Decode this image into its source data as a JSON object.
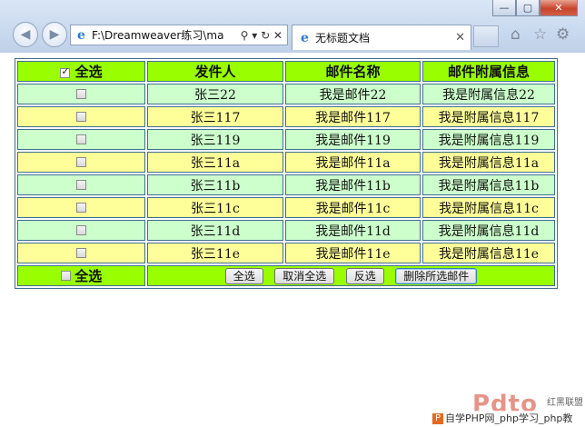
{
  "window": {
    "minimize_glyph": "—",
    "maximize_glyph": "▢",
    "close_glyph": "✕"
  },
  "browser": {
    "address": "F:\\Dreamweaver练习\\ma",
    "address_controls": "⚲ ▾ ↻ ✕",
    "tab_title": "无标题文档",
    "tab_close": "✕",
    "icons": [
      "back-icon",
      "forward-icon",
      "ie-icon",
      "home-icon",
      "star-icon",
      "gear-icon"
    ]
  },
  "table": {
    "headers": {
      "select_all": "全选",
      "sender": "发件人",
      "subject": "邮件名称",
      "attachment": "邮件附属信息"
    },
    "rows": [
      {
        "sender": "张三22",
        "subject": "我是邮件22",
        "attachment": "我是附属信息22"
      },
      {
        "sender": "张三117",
        "subject": "我是邮件117",
        "attachment": "我是附属信息117"
      },
      {
        "sender": "张三119",
        "subject": "我是邮件119",
        "attachment": "我是附属信息119"
      },
      {
        "sender": "张三11a",
        "subject": "我是邮件11a",
        "attachment": "我是附属信息11a"
      },
      {
        "sender": "张三11b",
        "subject": "我是邮件11b",
        "attachment": "我是附属信息11b"
      },
      {
        "sender": "张三11c",
        "subject": "我是邮件11c",
        "attachment": "我是附属信息11c"
      },
      {
        "sender": "张三11d",
        "subject": "我是邮件11d",
        "attachment": "我是附属信息11d"
      },
      {
        "sender": "张三11e",
        "subject": "我是邮件11e",
        "attachment": "我是附属信息11e"
      }
    ],
    "footer": {
      "select_all": "全选",
      "buttons": {
        "select_all": "全选",
        "deselect_all": "取消全选",
        "invert": "反选",
        "delete_selected": "删除所选邮件"
      }
    },
    "colors": {
      "header": "#99ff00",
      "row_green": "#ccffcc",
      "row_yellow": "#ffff99",
      "border": "#3f6f91"
    }
  },
  "watermark": {
    "logo": "Pdto",
    "tag": "红黑联盟",
    "caption": "自学PHP网_php学习_php教"
  }
}
